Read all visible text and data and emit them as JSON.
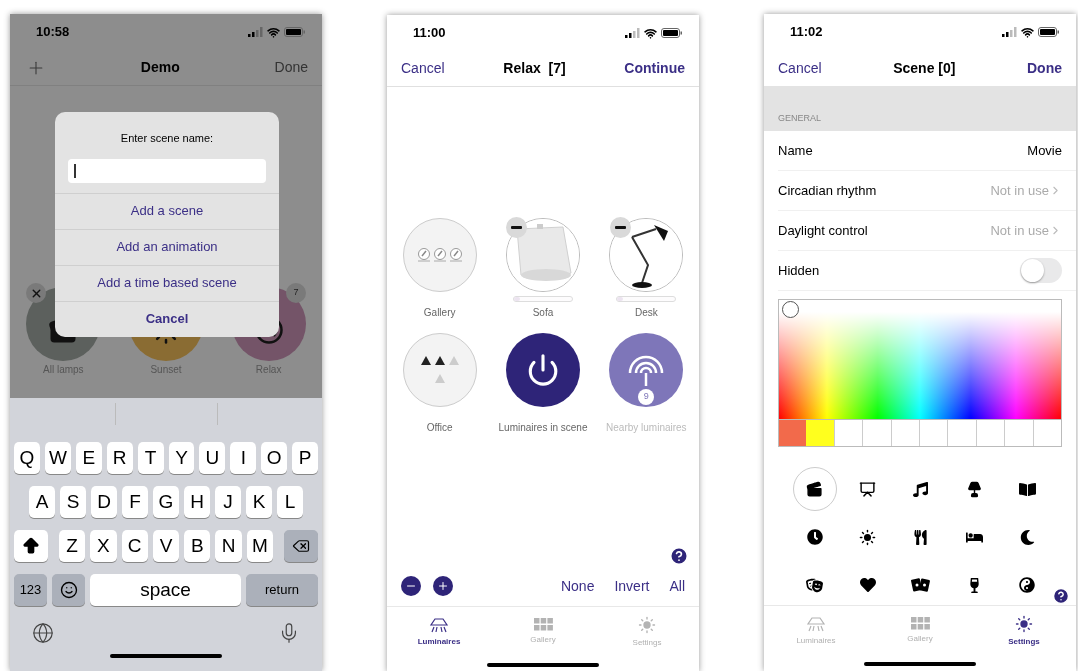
{
  "phone_1": {
    "status_time": "10:58",
    "title": "Demo",
    "done": "Done",
    "scenes": [
      {
        "label": "All lamps",
        "kind": "clapper",
        "color": "#5c605d",
        "removable": true
      },
      {
        "label": "Sunset",
        "kind": "sun",
        "color": "#8a6c33",
        "removable": false
      },
      {
        "label": "Relax",
        "kind": "disc",
        "color": "#745468",
        "removable": false,
        "count": "7"
      }
    ],
    "dialog": {
      "title": "Enter scene name:",
      "actions": [
        {
          "label": "Add a scene",
          "kind": "option"
        },
        {
          "label": "Add an animation",
          "kind": "option"
        },
        {
          "label": "Add a time based scene",
          "kind": "option"
        },
        {
          "label": "Cancel",
          "kind": "cancel"
        }
      ]
    },
    "keyboard": {
      "rows": [
        [
          "Q",
          "W",
          "E",
          "R",
          "T",
          "Y",
          "U",
          "I",
          "O",
          "P"
        ],
        [
          "A",
          "S",
          "D",
          "F",
          "G",
          "H",
          "J",
          "K",
          "L"
        ],
        [
          "Z",
          "X",
          "C",
          "V",
          "B",
          "N",
          "M"
        ]
      ],
      "numbers": "123",
      "space": "space",
      "return": "return"
    }
  },
  "phone_2": {
    "status_time": "11:00",
    "cancel": "Cancel",
    "title": "Relax  [7]",
    "continue": "Continue",
    "tiles": [
      {
        "label": "Gallery",
        "kind": "gallery",
        "removable": false,
        "disabled": false
      },
      {
        "label": "Sofa",
        "kind": "sofa",
        "removable": true,
        "level": 0,
        "disabled": false
      },
      {
        "label": "Desk",
        "kind": "desk",
        "removable": true,
        "level": 0,
        "disabled": false
      },
      {
        "label": "Office",
        "kind": "office",
        "removable": false,
        "disabled": false
      },
      {
        "label": "Luminaires in scene",
        "kind": "power",
        "removable": false,
        "disabled": false
      },
      {
        "label": "Nearby luminaires",
        "kind": "nearby",
        "removable": false,
        "disabled": true,
        "count": "9"
      }
    ],
    "selection_actions": [
      "None",
      "Invert",
      "All"
    ],
    "tabs": [
      {
        "label": "Luminaires",
        "kind": "lamp",
        "selected": true
      },
      {
        "label": "Gallery",
        "kind": "grid",
        "selected": false
      },
      {
        "label": "Settings",
        "kind": "sun",
        "selected": false
      }
    ]
  },
  "phone_3": {
    "status_time": "11:02",
    "cancel": "Cancel",
    "title": "Scene [0]",
    "done": "Done",
    "section": "GENERAL",
    "rows": [
      {
        "kind": "value",
        "label": "Name",
        "value": "Movie"
      },
      {
        "kind": "link",
        "label": "Circadian rhythm",
        "value": "Not in use"
      },
      {
        "kind": "link",
        "label": "Daylight control",
        "value": "Not in use"
      },
      {
        "kind": "toggle",
        "label": "Hidden",
        "on": false
      }
    ],
    "swatches": [
      {
        "color": "#f26a4b"
      },
      {
        "color": "#ffff1e"
      }
    ],
    "scene_icons": [
      {
        "kind": "movie",
        "selected": true
      },
      {
        "kind": "presentation",
        "selected": false
      },
      {
        "kind": "music",
        "selected": false
      },
      {
        "kind": "lamp",
        "selected": false
      },
      {
        "kind": "book",
        "selected": false
      },
      {
        "kind": "clock",
        "selected": false
      },
      {
        "kind": "sun",
        "selected": false
      },
      {
        "kind": "dining",
        "selected": false
      },
      {
        "kind": "bed",
        "selected": false
      },
      {
        "kind": "moon",
        "selected": false
      },
      {
        "kind": "mask",
        "selected": false
      },
      {
        "kind": "heart",
        "selected": false
      },
      {
        "kind": "cards",
        "selected": false
      },
      {
        "kind": "wine",
        "selected": false
      },
      {
        "kind": "yinyang",
        "selected": false
      }
    ],
    "tabs": [
      {
        "label": "Luminaires",
        "kind": "lamp",
        "selected": false
      },
      {
        "label": "Gallery",
        "kind": "grid",
        "selected": false
      },
      {
        "label": "Settings",
        "kind": "sun",
        "selected": true
      }
    ]
  }
}
